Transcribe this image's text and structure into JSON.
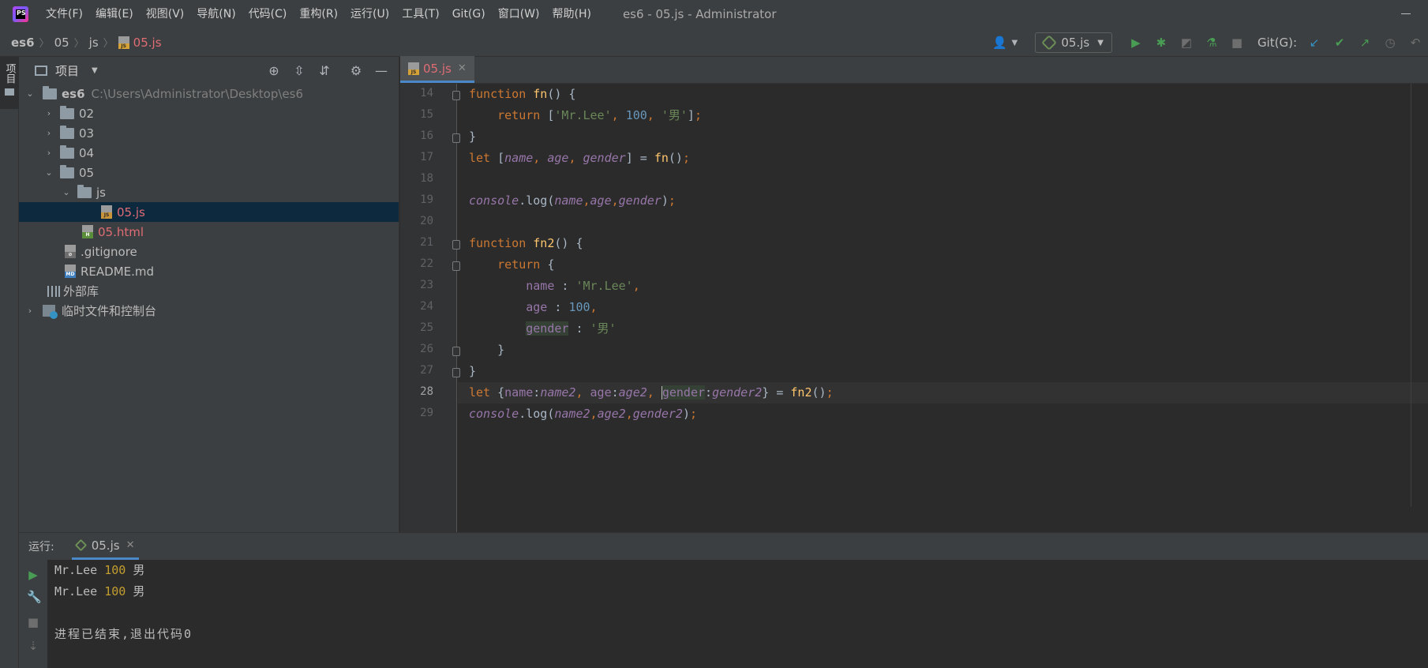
{
  "window": {
    "title": "es6 - 05.js - Administrator",
    "logo_text": "PS"
  },
  "menu": [
    "文件(F)",
    "编辑(E)",
    "视图(V)",
    "导航(N)",
    "代码(C)",
    "重构(R)",
    "运行(U)",
    "工具(T)",
    "Git(G)",
    "窗口(W)",
    "帮助(H)"
  ],
  "breadcrumb": {
    "items": [
      "es6",
      "05",
      "js"
    ],
    "file": "05.js"
  },
  "toolbar": {
    "run_config": "05.js",
    "git_label": "Git(G):"
  },
  "left_stripe": {
    "project_tab": "项目"
  },
  "project_panel": {
    "title": "项目",
    "root": {
      "name": "es6",
      "path": "C:\\Users\\Administrator\\Desktop\\es6"
    },
    "folders": [
      "02",
      "03",
      "04",
      "05"
    ],
    "subfolder": "js",
    "files": {
      "js_file": "05.js",
      "html_file": "05.html",
      "gitignore": ".gitignore",
      "readme": "README.md"
    },
    "external_libs": "外部库",
    "scratches": "临时文件和控制台"
  },
  "editor": {
    "tab": "05.js",
    "line_numbers": [
      "14",
      "15",
      "16",
      "17",
      "18",
      "19",
      "20",
      "21",
      "22",
      "23",
      "24",
      "25",
      "26",
      "27",
      "28",
      "29"
    ],
    "current_line": "28",
    "tokens": {
      "function": "function",
      "return": "return",
      "let": "let",
      "fn": "fn",
      "fn2": "fn2",
      "console": "console",
      "log": "log",
      "str_mrlee": "'Mr.Lee'",
      "str_male": "'男'",
      "n100": "100",
      "name": "name",
      "age": "age",
      "gender": "gender",
      "name2": "name2",
      "age2": "age2",
      "gender2": "gender2"
    }
  },
  "run_panel": {
    "label": "运行:",
    "tab": "05.js",
    "output": [
      {
        "text": "Mr.Lee",
        "num": "100",
        "tail": "男"
      },
      {
        "text": "Mr.Lee",
        "num": "100",
        "tail": "男"
      }
    ],
    "exit_message": "进程已结束,退出代码0"
  },
  "colors": {
    "keyword": "#cc7832",
    "function_name": "#ffc66d",
    "string": "#6a8759",
    "number": "#6897bb",
    "variable": "#9876aa",
    "modified_file": "#e06c75",
    "run_green": "#499c54"
  }
}
